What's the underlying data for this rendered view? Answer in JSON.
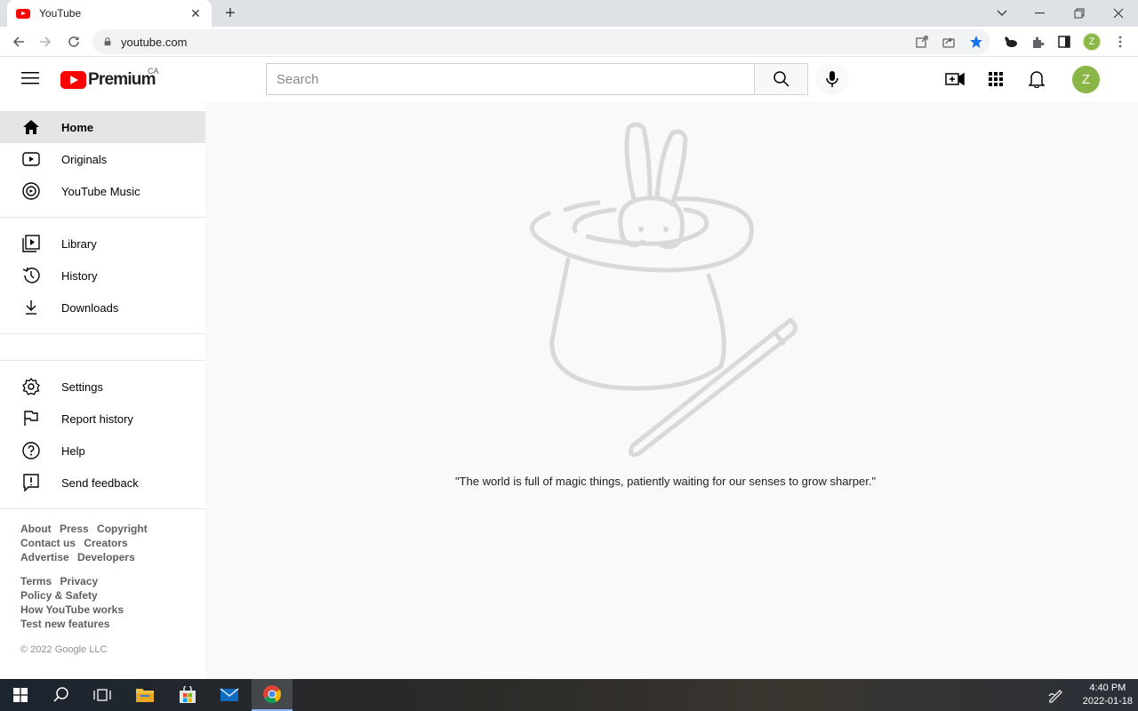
{
  "browser": {
    "tab_title": "YouTube",
    "url": "youtube.com",
    "profile_initial": "Z"
  },
  "masthead": {
    "logo_text": "Premium",
    "country_code": "CA",
    "search_placeholder": "Search",
    "avatar_initial": "Z"
  },
  "sidebar": {
    "primary": [
      {
        "label": "Home",
        "icon": "home-icon",
        "active": true
      },
      {
        "label": "Originals",
        "icon": "originals-icon"
      },
      {
        "label": "YouTube Music",
        "icon": "music-icon"
      }
    ],
    "secondary": [
      {
        "label": "Library",
        "icon": "library-icon"
      },
      {
        "label": "History",
        "icon": "history-icon"
      },
      {
        "label": "Downloads",
        "icon": "download-icon"
      }
    ],
    "tertiary": [
      {
        "label": "Settings",
        "icon": "gear-icon"
      },
      {
        "label": "Report history",
        "icon": "flag-icon"
      },
      {
        "label": "Help",
        "icon": "help-icon"
      },
      {
        "label": "Send feedback",
        "icon": "feedback-icon"
      }
    ],
    "footer_links_1": [
      "About",
      "Press",
      "Copyright",
      "Contact us",
      "Creators",
      "Advertise",
      "Developers"
    ],
    "footer_links_2": [
      "Terms",
      "Privacy",
      "Policy & Safety",
      "How YouTube works",
      "Test new features"
    ],
    "copyright": "© 2022 Google LLC"
  },
  "main": {
    "quote": "\"The world is full of magic things, patiently waiting for our senses to grow sharper.\""
  },
  "taskbar": {
    "time": "4:40 PM",
    "date": "2022-01-18"
  },
  "colors": {
    "brand_red": "#ff0000",
    "avatar_green": "#8ab547",
    "active_bg": "#e5e5e5",
    "main_bg": "#f9f9f9"
  }
}
